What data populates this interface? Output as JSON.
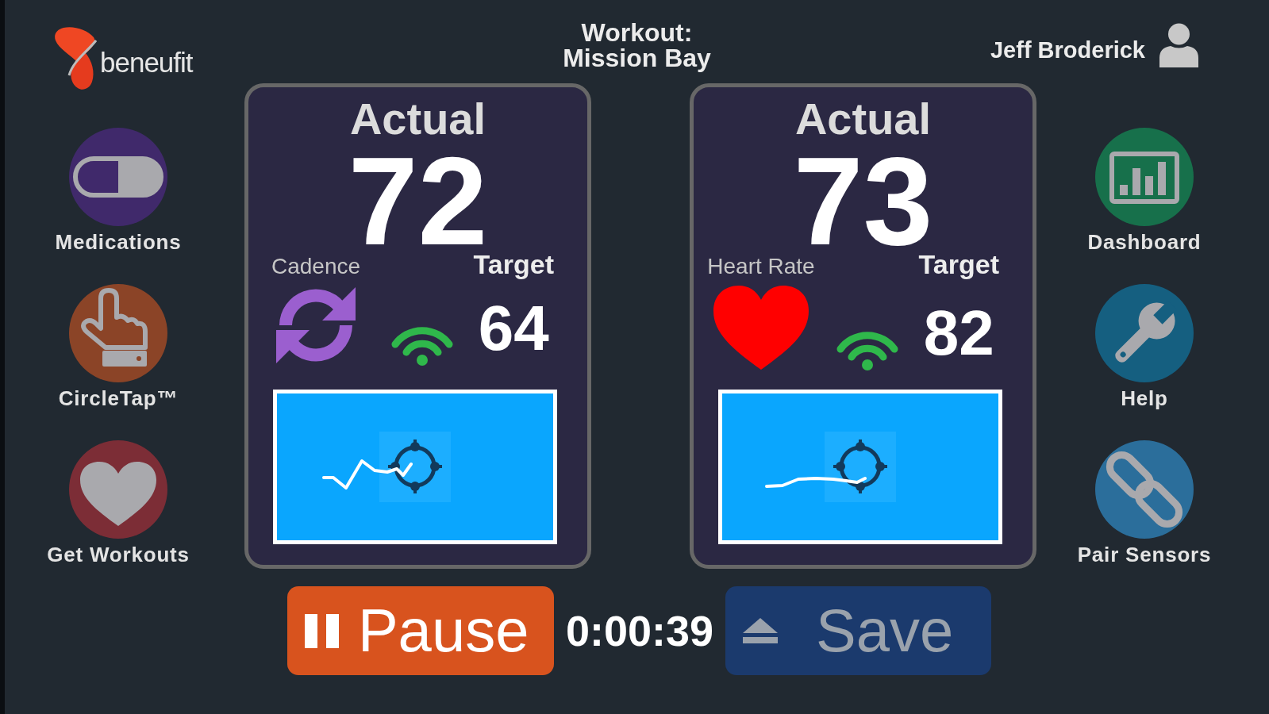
{
  "header": {
    "logo_text": "beneufit",
    "workout_label": "Workout:",
    "workout_name": "Mission Bay",
    "user_name": "Jeff Broderick"
  },
  "left_nav": [
    {
      "kind": "medications",
      "label": "Medications",
      "color": "#40296b"
    },
    {
      "kind": "circletap",
      "label": "CircleTap™",
      "color": "#8b4427"
    },
    {
      "kind": "workouts",
      "label": "Get Workouts",
      "color": "#7c2d36"
    }
  ],
  "right_nav": [
    {
      "kind": "dashboard",
      "label": "Dashboard",
      "color": "#17704b"
    },
    {
      "kind": "help",
      "label": "Help",
      "color": "#155f80"
    },
    {
      "kind": "pair",
      "label": "Pair Sensors",
      "color": "#2b6e9b"
    }
  ],
  "cards": [
    {
      "kind": "cadence",
      "heading": "Actual",
      "value": "72",
      "metric": "Cadence",
      "target_label": "Target",
      "target": "64"
    },
    {
      "kind": "heart_rate",
      "heading": "Actual",
      "value": "73",
      "metric": "Heart Rate",
      "target_label": "Target",
      "target": "82"
    }
  ],
  "controls": {
    "pause": {
      "label": "Pause",
      "disabled": false
    },
    "timer": "0:00:39",
    "save": {
      "label": "Save",
      "disabled": true
    }
  }
}
